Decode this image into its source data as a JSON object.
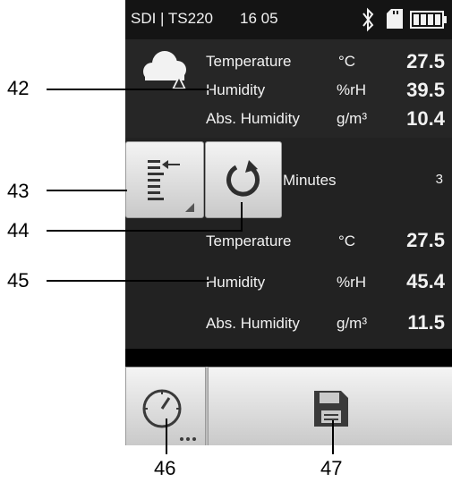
{
  "status": {
    "device": "SDI | TS220",
    "time": "16 05"
  },
  "icons": {
    "weather": "cloud-rain-icon",
    "bluetooth": "bluetooth-icon",
    "sdcard": "sd-card-icon",
    "battery": "battery-icon",
    "list": "list-arrow-icon",
    "refresh": "refresh-icon",
    "clock": "clock-icon",
    "save": "floppy-disk-icon"
  },
  "top": {
    "rows": [
      {
        "label": "Temperature",
        "unit": "°C",
        "value": "27.5"
      },
      {
        "label": "Humidity",
        "unit": "%rH",
        "value": "39.5"
      },
      {
        "label": "Abs. Humidity",
        "unit": "g/m³",
        "value": "10.4"
      }
    ]
  },
  "middle": {
    "minutes_label": "Minutes",
    "minutes_value": "3",
    "rows": [
      {
        "label": "Temperature",
        "unit": "°C",
        "value": "27.5"
      },
      {
        "label": "Humidity",
        "unit": "%rH",
        "value": "45.4"
      },
      {
        "label": "Abs. Humidity",
        "unit": "g/m³",
        "value": "11.5"
      }
    ]
  },
  "callouts": [
    "42",
    "43",
    "44",
    "45",
    "46",
    "47"
  ],
  "colors": {
    "screen": "#1a1a1a",
    "panel": "#262626",
    "button": "#d9d9d9",
    "text": "#f2f2f2"
  }
}
